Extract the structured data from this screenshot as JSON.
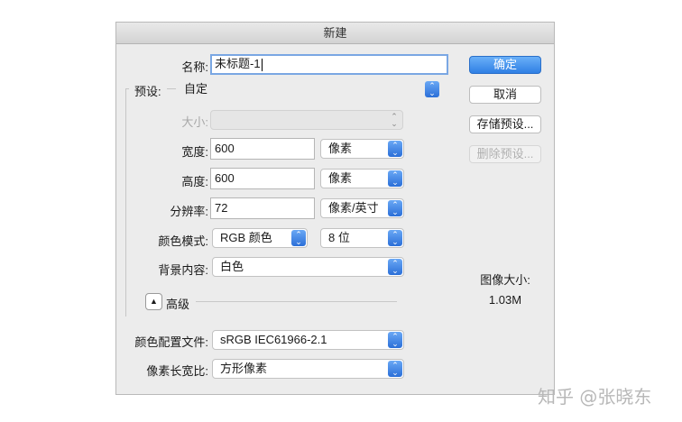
{
  "dialog": {
    "title": "新建",
    "name_label": "名称:",
    "name_value": "未标题-1",
    "preset_label": "预设:",
    "preset_value": "自定",
    "size_label": "大小:",
    "size_value": "",
    "width_label": "宽度:",
    "width_value": "600",
    "width_unit": "像素",
    "height_label": "高度:",
    "height_value": "600",
    "height_unit": "像素",
    "resolution_label": "分辨率:",
    "resolution_value": "72",
    "resolution_unit": "像素/英寸",
    "color_mode_label": "颜色模式:",
    "color_mode_value": "RGB 颜色",
    "bit_depth_value": "8 位",
    "background_label": "背景内容:",
    "background_value": "白色",
    "advanced_label": "高级",
    "color_profile_label": "颜色配置文件:",
    "color_profile_value": "sRGB IEC61966-2.1",
    "pixel_aspect_label": "像素长宽比:",
    "pixel_aspect_value": "方形像素"
  },
  "buttons": {
    "ok": "确定",
    "cancel": "取消",
    "save_preset": "存储预设...",
    "delete_preset": "删除预设..."
  },
  "image_size": {
    "label": "图像大小:",
    "value": "1.03M"
  },
  "watermark": "知乎 @张晓东",
  "icons": {
    "stepper": "up-down-chevron-icon",
    "advanced_toggle": "triangle-up-icon"
  }
}
